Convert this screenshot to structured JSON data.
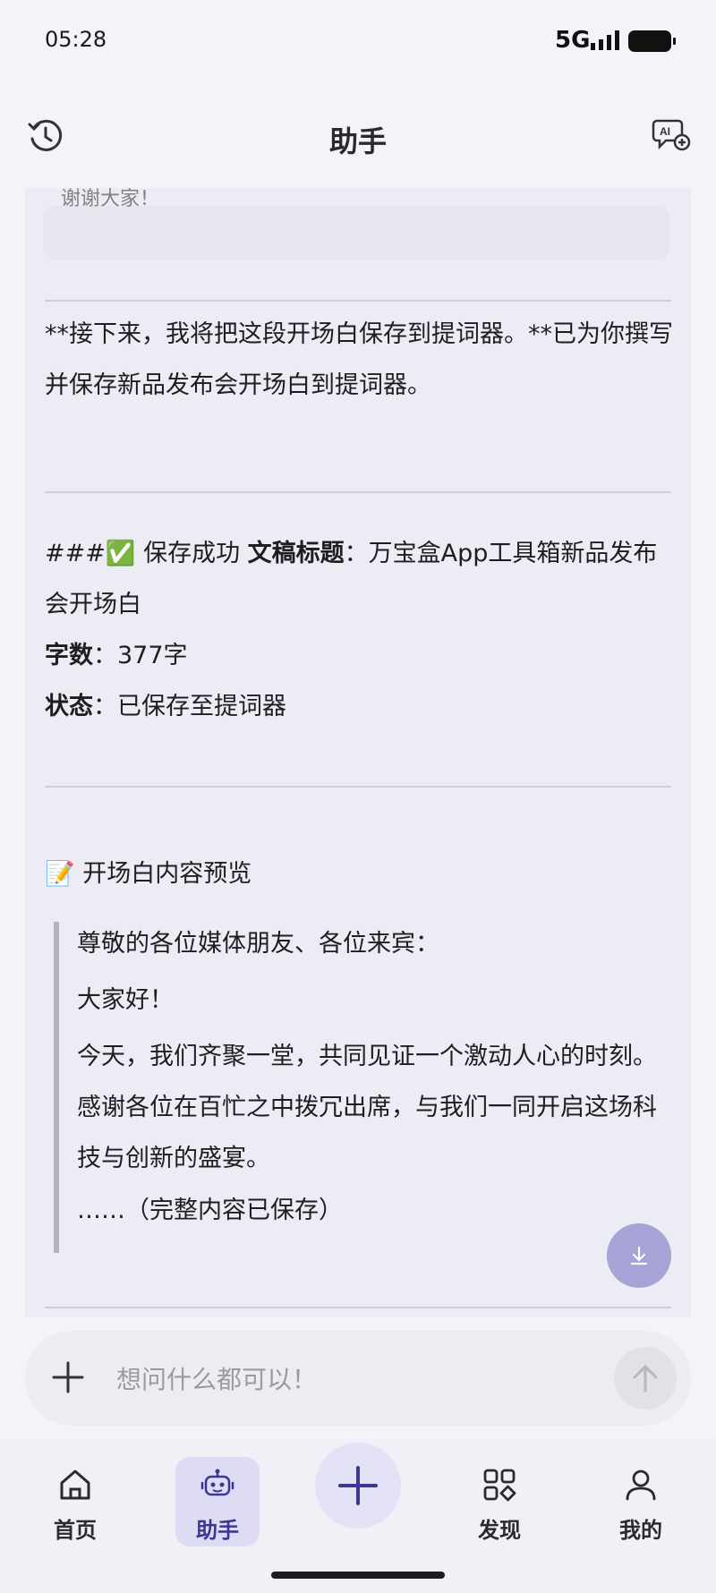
{
  "status_bar": {
    "time": "05:28",
    "network": "5G"
  },
  "header": {
    "title": "助手"
  },
  "message": {
    "faded_line": "谢谢大家！",
    "next_step_text": "**接下来，我将把这段开场白保存到提词器。**已为你撰写并保存新品发布会开场白到提词器。",
    "save_heading_prefix": "###✅ 保存成功 ",
    "doc_title_label": "文稿标题",
    "doc_title_value": "：万宝盒App工具箱新品发布会开场白",
    "word_count_label": "字数",
    "word_count_value": "：377字",
    "status_label": "状态",
    "status_value": "：已保存至提词器",
    "preview_title": "📝 开场白内容预览",
    "quote_lines": [
      "尊敬的各位媒体朋友、各位来宾：",
      "大家好！",
      "今天，我们齐聚一堂，共同见证一个激动人心的时刻。感谢各位在百忙之中拨冗出席，与我们一同开启这场科技与创新的盛宴。",
      "……（完整内容已保存）"
    ]
  },
  "input": {
    "placeholder": "想问什么都可以！"
  },
  "nav": {
    "items": [
      {
        "label": "首页",
        "icon": "home-icon"
      },
      {
        "label": "助手",
        "icon": "robot-icon"
      },
      {
        "label": "发现",
        "icon": "grid-icon"
      },
      {
        "label": "我的",
        "icon": "person-icon"
      }
    ]
  },
  "colors": {
    "accent": "#3d3794",
    "fab": "#a7a3d6"
  }
}
